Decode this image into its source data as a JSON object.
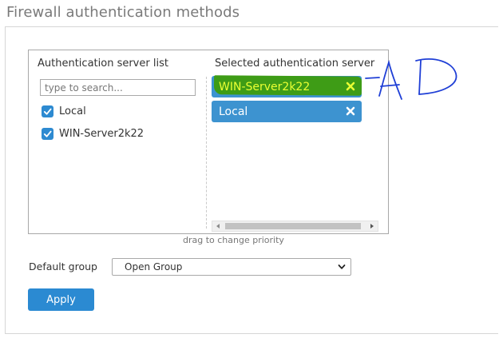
{
  "page": {
    "title": "Firewall authentication methods"
  },
  "server_list": {
    "header": "Authentication server list",
    "search_placeholder": "type to search...",
    "items": [
      {
        "label": "Local",
        "checked": true
      },
      {
        "label": "WIN-Server2k22",
        "checked": true
      }
    ]
  },
  "selected_servers": {
    "header": "Selected authentication server",
    "items": [
      {
        "label": "WIN-Server2k22",
        "remove_icon": "close-icon"
      },
      {
        "label": "Local",
        "remove_icon": "close-icon"
      }
    ],
    "drag_hint": "drag to change priority"
  },
  "default_group": {
    "label": "Default group",
    "selected": "Open Group"
  },
  "apply_label": "Apply",
  "annotation": {
    "kind": "handwritten",
    "text": "AD"
  },
  "colors": {
    "accent": "#2b8ad2",
    "chip": "#3d93d0",
    "highlight": "#3e9c16",
    "highlight_text": "#e9ff33",
    "annotation_ink": "#1f3fd6"
  }
}
